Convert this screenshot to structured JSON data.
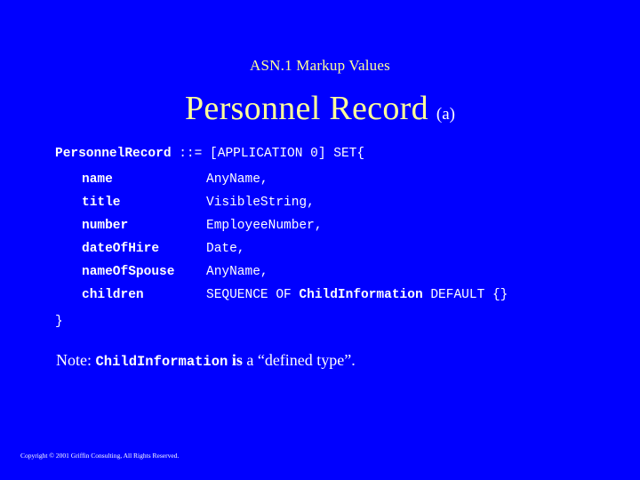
{
  "slide": {
    "background_color": "#0000ff",
    "heading_color": "#ffff99",
    "body_color": "#ffffff",
    "subtitle": "ASN.1 Markup Values",
    "title": "Personnel Record",
    "title_suffix": "(a)"
  },
  "code": {
    "header": {
      "type_name": "PersonnelRecord",
      "rest": " ::= [APPLICATION 0] SET{"
    },
    "fields": [
      {
        "name": "name",
        "type": "AnyName,"
      },
      {
        "name": "title",
        "type": "VisibleString,"
      },
      {
        "name": "number",
        "type": "EmployeeNumber,"
      },
      {
        "name": "dateOfHire",
        "type": "Date,"
      },
      {
        "name": "nameOfSpouse",
        "type": "AnyName,"
      }
    ],
    "children_row": {
      "name": "children",
      "type_prefix": "SEQUENCE OF ",
      "type_bold": "ChildInformation",
      "type_suffix": " DEFAULT {}"
    },
    "closing_brace": "}"
  },
  "note": {
    "prefix": "Note: ",
    "mono_term": "ChildInformation",
    "verb": " is ",
    "suffix": "a “defined type”."
  },
  "footer": {
    "copyright": "Copyright © 2001 Griffin Consulting, All Rights Reserved."
  }
}
